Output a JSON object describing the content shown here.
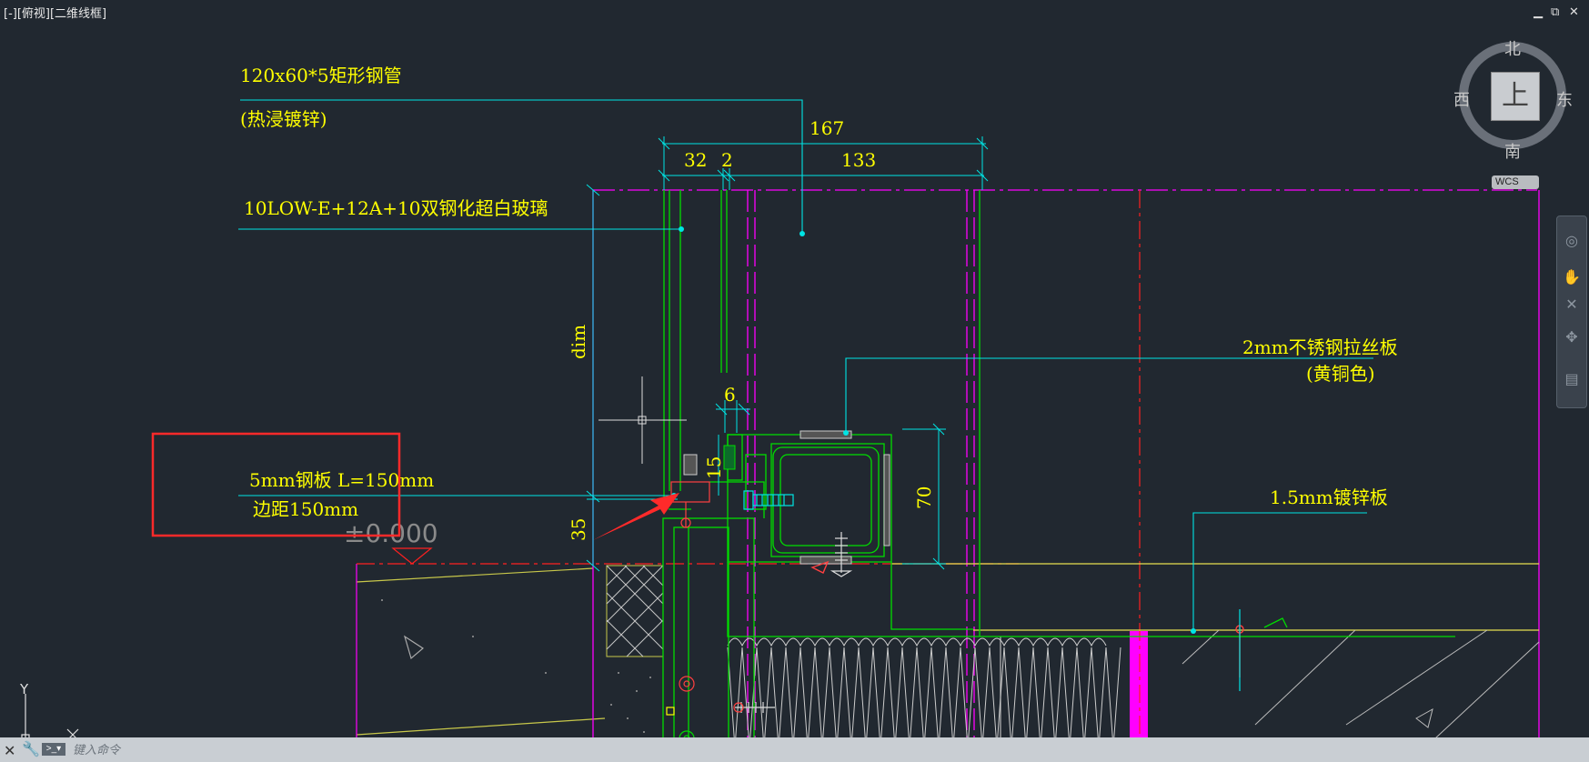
{
  "viewport": {
    "label": "[-][俯视][二维线框]",
    "window_controls": [
      "▁",
      "⧉",
      "✕"
    ]
  },
  "viewcube": {
    "north": "北",
    "south": "南",
    "east": "东",
    "west": "西",
    "top_face": "上",
    "wcs": "WCS"
  },
  "navbar": {
    "tools": [
      "steering-wheel-icon",
      "pan-icon",
      "zoom-extents-icon",
      "orbit-icon",
      "showmotion-icon"
    ]
  },
  "drawing": {
    "annotations": {
      "steel_tube": "120x60*5矩形钢管",
      "hot_dip": "(热浸镀锌)",
      "glass": "10LOW-E+12A+10双钢化超白玻璃",
      "stainless_panel": "2mm不锈钢拉丝板",
      "brass_color": "(黄铜色)",
      "galvanized_panel": "1.5mm镀锌板",
      "steel_plate": "5mm钢板 L=150mm",
      "edge_distance": "边距150mm",
      "elevation": "±0.000"
    },
    "dimensions": {
      "d167": "167",
      "d32": "32",
      "d2": "2",
      "d133": "133",
      "d6": "6",
      "d15": "15",
      "d70": "70",
      "d35": "35",
      "dim_text": "dim"
    },
    "ucs": {
      "x": "X",
      "y": "Y"
    },
    "colors": {
      "background": "#212830",
      "annotation_text": "#ffff00",
      "leader": "#00e5e5",
      "green_detail": "#00dd00",
      "magenta_line": "#ff00ff",
      "red_axis": "#ff2020",
      "highlight_box": "#ff2a2a"
    }
  },
  "command_line": {
    "placeholder": "键入命令"
  }
}
